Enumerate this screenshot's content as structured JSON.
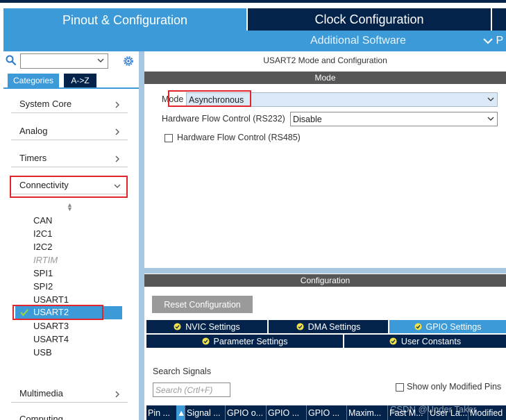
{
  "tabs": {
    "pinout": "Pinout & Configuration",
    "clock": "Clock Configuration",
    "additional_software": "Additional Software",
    "overflow_letter": "P"
  },
  "left_panel": {
    "search_placeholder": "",
    "categories_tab": "Categories",
    "az_tab": "A->Z",
    "categories": [
      {
        "label": "System Core"
      },
      {
        "label": "Analog"
      },
      {
        "label": "Timers"
      },
      {
        "label": "Connectivity",
        "expanded": true
      },
      {
        "label": "Multimedia"
      }
    ],
    "peripherals": [
      {
        "label": "CAN",
        "enabled": true
      },
      {
        "label": "I2C1",
        "enabled": true
      },
      {
        "label": "I2C2",
        "enabled": true
      },
      {
        "label": "IRTIM",
        "enabled": false
      },
      {
        "label": "SPI1",
        "enabled": true
      },
      {
        "label": "SPI2",
        "enabled": true
      },
      {
        "label": "USART1",
        "enabled": true
      },
      {
        "label": "USART2",
        "enabled": true,
        "selected": true,
        "configured": true
      },
      {
        "label": "USART3",
        "enabled": true
      },
      {
        "label": "USART4",
        "enabled": true
      },
      {
        "label": "USB",
        "enabled": true
      }
    ],
    "more_item": "Computing"
  },
  "right_panel": {
    "title": "USART2 Mode and Configuration",
    "mode_header": "Mode",
    "mode_label": "Mode",
    "mode_value": "Asynchronous",
    "hw_flow_232_label": "Hardware Flow Control (RS232)",
    "hw_flow_232_value": "Disable",
    "hw_flow_485_label": "Hardware Flow Control (RS485)",
    "hw_flow_485_checked": false,
    "config_header": "Configuration",
    "reset_button": "Reset Configuration",
    "settings_tabs": [
      {
        "label": "NVIC Settings",
        "active": false
      },
      {
        "label": "DMA Settings",
        "active": false
      },
      {
        "label": "GPIO Settings",
        "active": true
      },
      {
        "label": "Parameter Settings",
        "active": false
      },
      {
        "label": "User Constants",
        "active": false
      }
    ],
    "search_signals_label": "Search Signals",
    "search_signals_placeholder": "Search (Crtl+F)",
    "show_modified_label": "Show only Modified Pins",
    "table_columns": [
      "Pin ...",
      "Signal ...",
      "GPIO o...",
      "GPIO ...",
      "GPIO ...",
      "Maxim...",
      "Fast M...",
      "User La...",
      "Modified"
    ]
  },
  "watermark": "CSDN @Under Taker",
  "colors": {
    "accent": "#3b9ad7",
    "dark": "#03234b",
    "highlight_box": "#e0262c",
    "header_grey": "#565656"
  }
}
